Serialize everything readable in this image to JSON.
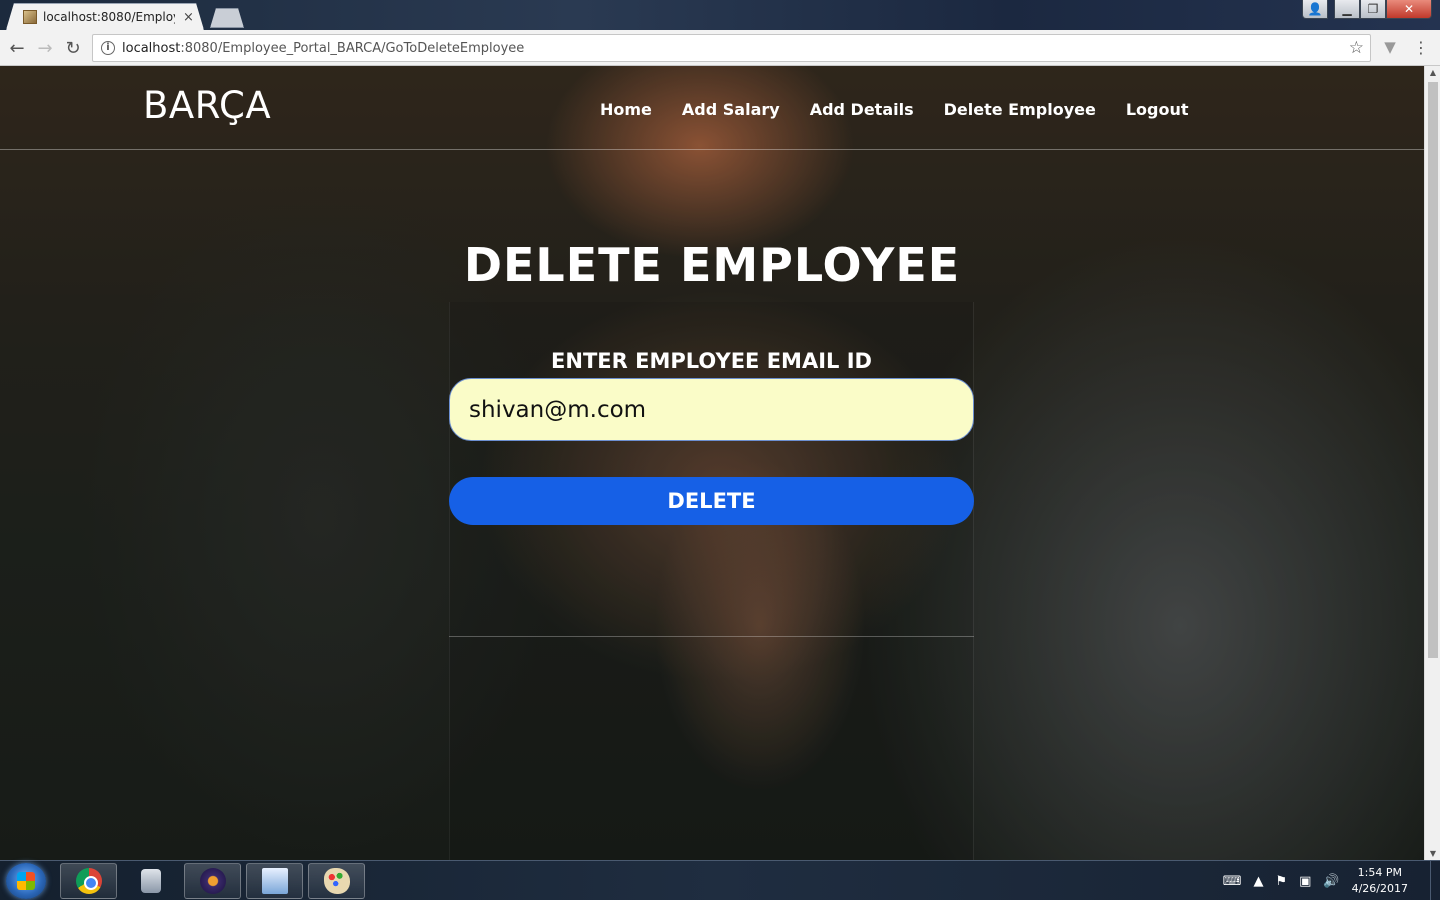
{
  "browser": {
    "tab_title": "localhost:8080/Employee",
    "tab_close": "×",
    "url_host": "localhost",
    "url_rest": ":8080/Employee_Portal_BARCA/GoToDeleteEmployee",
    "nav_back": "←",
    "nav_forward": "→",
    "nav_reload": "↻",
    "star": "☆",
    "menu": "⋮"
  },
  "site": {
    "brand": "BARÇA",
    "nav": {
      "home": "Home",
      "add_salary": "Add Salary",
      "add_details": "Add Details",
      "delete_employee": "Delete Employee",
      "logout": "Logout"
    }
  },
  "form": {
    "page_title": "DELETE EMPLOYEE",
    "field_label": "ENTER EMPLOYEE EMAIL ID",
    "email_value": "shivan@m.com",
    "submit_label": "DELETE"
  },
  "taskbar": {
    "apps": [
      "chrome-icon",
      "database-icon",
      "eclipse-icon",
      "file-manager-icon",
      "paint-icon"
    ],
    "time": "1:54 PM",
    "date": "4/26/2017"
  },
  "colors": {
    "button_blue": "#1660e6",
    "input_bg": "#fafcc8"
  }
}
